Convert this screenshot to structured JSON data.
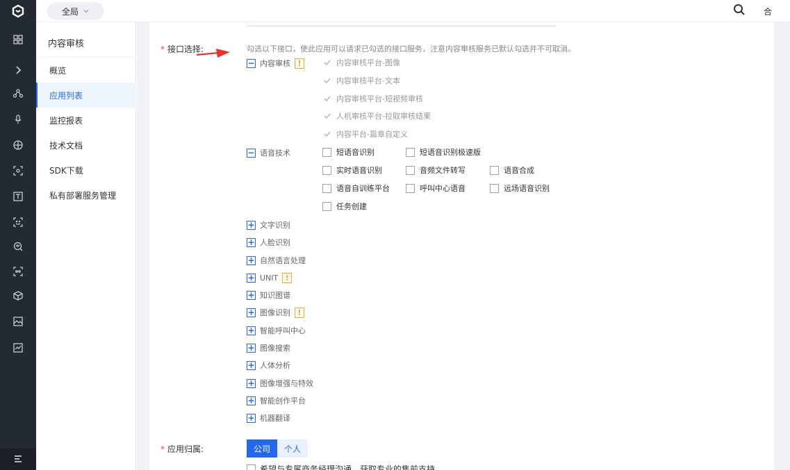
{
  "topbar": {
    "scope_label": "全局",
    "cut_text": "合"
  },
  "subnav": {
    "title": "内容审核",
    "items": [
      {
        "label": "概览",
        "active": false
      },
      {
        "label": "应用列表",
        "active": true
      },
      {
        "label": "监控报表",
        "active": false
      },
      {
        "label": "技术文档",
        "active": false
      },
      {
        "label": "SDK下载",
        "active": false
      },
      {
        "label": "私有部署服务管理",
        "active": false
      }
    ]
  },
  "form": {
    "api_label": "接口选择:",
    "api_hint": "勾选以下接口，使此应用可以请求已勾选的接口服务，注意内容审核服务已默认勾选并不可取消。",
    "warn_glyph": "!",
    "content_review": {
      "label": "内容审核",
      "toggle": "−",
      "items": [
        "内容审核平台-图像",
        "内容审核平台-文本",
        "内容审核平台-短视频审核",
        "人机审核平台-拉取审核结果",
        "内容平台-篇章自定义"
      ]
    },
    "speech": {
      "label": "语音技术",
      "toggle": "−",
      "items": [
        "短语音识别",
        "短语音识别极速版",
        "实时语音识别",
        "音频文件转写",
        "语音合成",
        "语音自训练平台",
        "呼叫中心语音",
        "远场语音识别",
        "任务创建"
      ]
    },
    "collapsed_groups": [
      {
        "label": "文字识别",
        "warn": false
      },
      {
        "label": "人脸识别",
        "warn": false
      },
      {
        "label": "自然语言处理",
        "warn": false
      },
      {
        "label": "UNIT",
        "warn": true
      },
      {
        "label": "知识图谱",
        "warn": false
      },
      {
        "label": "图像识别",
        "warn": true
      },
      {
        "label": "智能呼叫中心",
        "warn": false
      },
      {
        "label": "图像搜索",
        "warn": false
      },
      {
        "label": "人体分析",
        "warn": false
      },
      {
        "label": "图像增强与特效",
        "warn": false
      },
      {
        "label": "智能创作平台",
        "warn": false
      },
      {
        "label": "机器翻译",
        "warn": false
      }
    ],
    "expand_glyph": "+",
    "ownership_label": "应用归属:",
    "ownership_options": [
      "公司",
      "个人"
    ],
    "consult_text": "希望与专属商务经理沟通，获取专业的售前支持"
  },
  "icons": [
    "logo-icon",
    "grid-icon",
    "chevron-right-icon",
    "nodes-icon",
    "microphone-icon",
    "globe-icon",
    "scan-icon",
    "text-icon",
    "face-icon",
    "analytics-icon",
    "face-scan-icon",
    "cube-icon",
    "image-icon",
    "chart-icon",
    "menu-icon"
  ]
}
